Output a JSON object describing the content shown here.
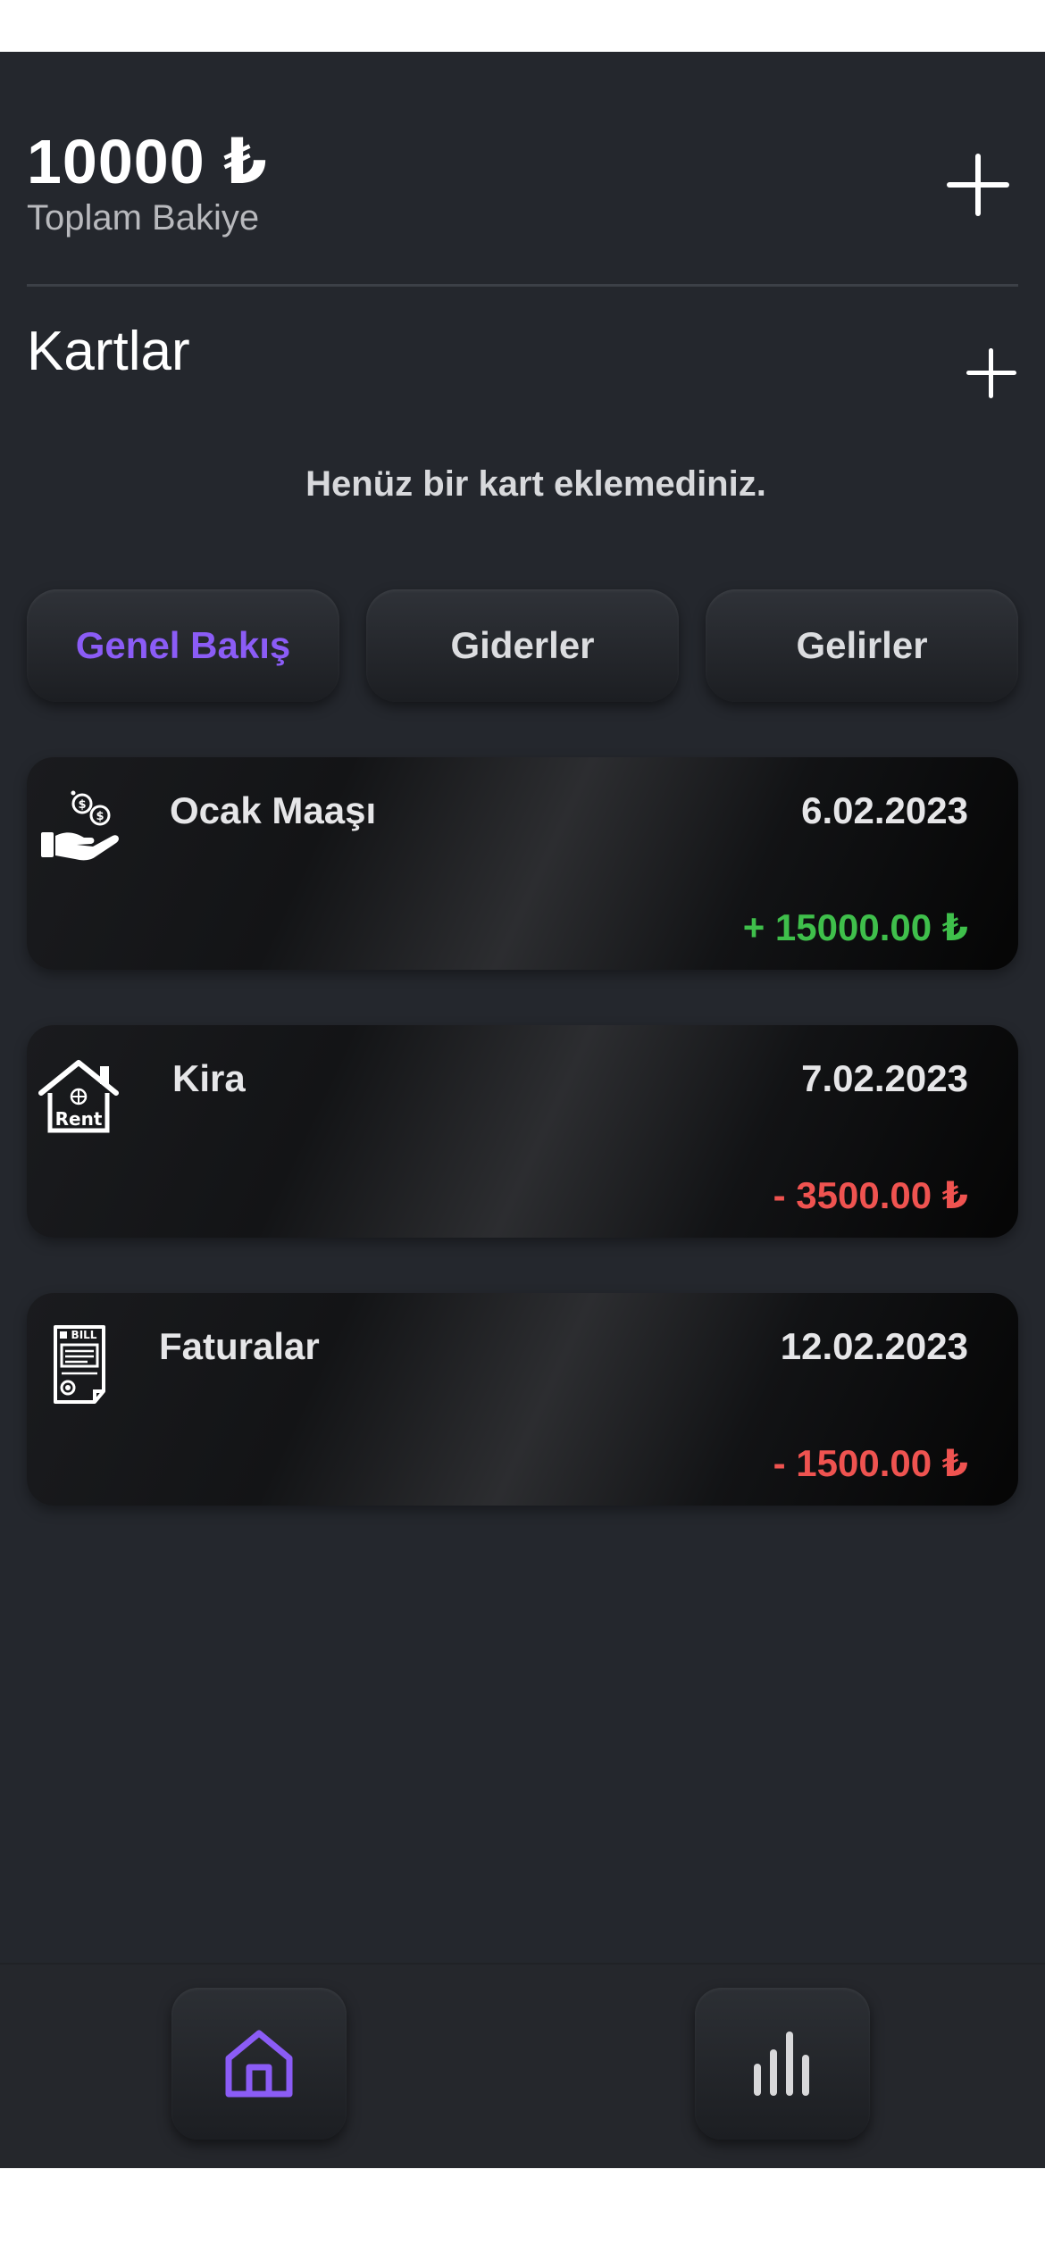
{
  "header": {
    "balance": "10000 ₺",
    "balance_label": "Toplam Bakiye"
  },
  "cards": {
    "title": "Kartlar",
    "empty_message": "Henüz bir kart eklemediniz."
  },
  "tabs": [
    {
      "label": "Genel Bakış",
      "active": true
    },
    {
      "label": "Giderler",
      "active": false
    },
    {
      "label": "Gelirler",
      "active": false
    }
  ],
  "transactions": [
    {
      "title": "Ocak Maaşı",
      "date": "6.02.2023",
      "amount": "+ 15000.00 ₺",
      "type": "income",
      "icon": "salary-hand-coins-icon"
    },
    {
      "title": "Kira",
      "date": "7.02.2023",
      "amount": "- 3500.00 ₺",
      "type": "expense",
      "icon": "rent-house-icon"
    },
    {
      "title": "Faturalar",
      "date": "12.02.2023",
      "amount": "- 1500.00 ₺",
      "type": "expense",
      "icon": "bill-document-icon"
    }
  ],
  "icon_labels": {
    "rent": "Rent",
    "bill": "BILL"
  },
  "nav": {
    "home_icon": "home-icon",
    "stats_icon": "bar-chart-icon"
  },
  "colors": {
    "accent": "#8b5cf6",
    "income": "#3fbf4b",
    "expense": "#ef5350",
    "background": "#24272d"
  }
}
